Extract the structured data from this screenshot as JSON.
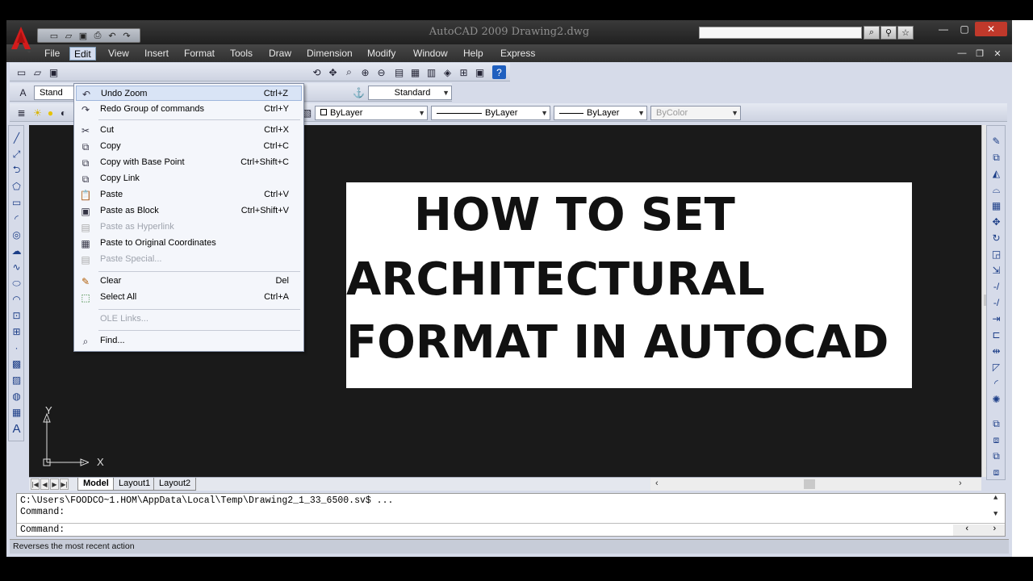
{
  "window": {
    "title": "AutoCAD 2009 Drawing2.dwg"
  },
  "menubar": {
    "items": [
      "File",
      "Edit",
      "View",
      "Insert",
      "Format",
      "Tools",
      "Draw",
      "Dimension",
      "Modify",
      "Window",
      "Help",
      "Express"
    ],
    "active": "Edit"
  },
  "toolbar": {
    "text_style": "Standard",
    "text_style_short": "Stand",
    "dim_style": "Standard",
    "color": "ByLayer",
    "linetype": "ByLayer",
    "lineweight": "ByLayer",
    "plot_style": "ByColor"
  },
  "edit_menu": {
    "items": [
      {
        "label": "Undo Zoom",
        "shortcut": "Ctrl+Z",
        "icon": "undo-icon"
      },
      {
        "label": "Redo Group of commands",
        "shortcut": "Ctrl+Y",
        "icon": "redo-icon"
      },
      {
        "label": "Cut",
        "shortcut": "Ctrl+X",
        "icon": "scissors-icon"
      },
      {
        "label": "Copy",
        "shortcut": "Ctrl+C",
        "icon": "copy-icon"
      },
      {
        "label": "Copy with Base Point",
        "shortcut": "Ctrl+Shift+C",
        "icon": "copy-base-icon"
      },
      {
        "label": "Copy Link",
        "shortcut": "",
        "icon": "copy-link-icon"
      },
      {
        "label": "Paste",
        "shortcut": "Ctrl+V",
        "icon": "paste-icon"
      },
      {
        "label": "Paste as Block",
        "shortcut": "Ctrl+Shift+V",
        "icon": "paste-block-icon"
      },
      {
        "label": "Paste as Hyperlink",
        "shortcut": "",
        "icon": "paste-hyperlink-icon"
      },
      {
        "label": "Paste to Original Coordinates",
        "shortcut": "",
        "icon": "paste-original-icon"
      },
      {
        "label": "Paste Special...",
        "shortcut": "",
        "icon": "paste-special-icon"
      },
      {
        "label": "Clear",
        "shortcut": "Del",
        "icon": "eraser-icon"
      },
      {
        "label": "Select All",
        "shortcut": "Ctrl+A",
        "icon": "select-all-icon"
      },
      {
        "label": "OLE Links...",
        "shortcut": "",
        "icon": ""
      },
      {
        "label": "Find...",
        "shortcut": "",
        "icon": "find-icon"
      }
    ]
  },
  "drawing": {
    "title_lines": [
      "HOW TO SET",
      "ARCHITECTURAL",
      "FORMAT IN AUTOCAD"
    ],
    "ucs_y": "Y",
    "ucs_x": "X"
  },
  "layout_tabs": [
    "Model",
    "Layout1",
    "Layout2"
  ],
  "command": {
    "history_line": "C:\\Users\\FOODCO~1.HOM\\AppData\\Local\\Temp\\Drawing2_1_33_6500.sv$ ...",
    "prompt_line": "Command:",
    "input_prompt": "Command:"
  },
  "status": {
    "text": "Reverses the most recent action"
  },
  "colors": {
    "canvas": "#1a1a1a",
    "menu_highlight": "#d9e4f6",
    "close_button": "#c0392b",
    "autocad_logo": "#d31c1c"
  }
}
